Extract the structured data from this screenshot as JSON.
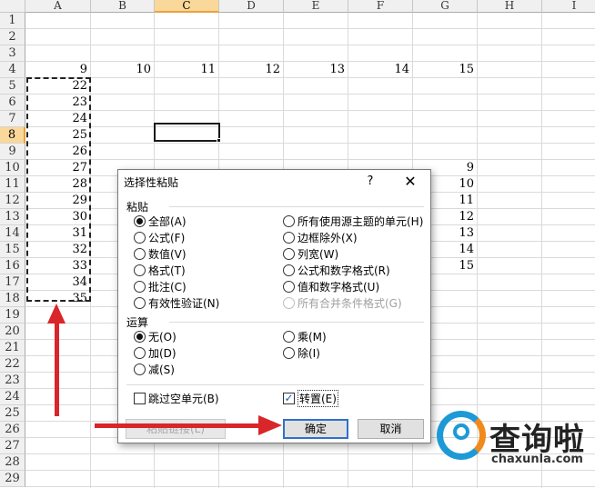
{
  "sheet": {
    "columns": [
      "A",
      "B",
      "C",
      "D",
      "E",
      "F",
      "G",
      "H",
      "I"
    ],
    "selected_column": "C",
    "rows": [
      "1",
      "2",
      "3",
      "4",
      "5",
      "6",
      "7",
      "8",
      "9",
      "10",
      "11",
      "12",
      "13",
      "14",
      "15",
      "16",
      "17",
      "18",
      "19",
      "20",
      "21",
      "22",
      "23",
      "24",
      "25",
      "26",
      "27",
      "28",
      "29"
    ],
    "selected_row": "8",
    "row4_values": [
      "9",
      "10",
      "11",
      "12",
      "13",
      "14",
      "15"
    ],
    "column_a_values": [
      "22",
      "23",
      "24",
      "25",
      "26",
      "27",
      "28",
      "29",
      "30",
      "31",
      "32",
      "33",
      "34",
      "35"
    ],
    "column_g_values": [
      "9",
      "10",
      "11",
      "12",
      "13",
      "14",
      "15"
    ]
  },
  "dialog": {
    "title": "选择性粘贴",
    "help": "?",
    "close": "✕",
    "paste_group": "粘贴",
    "paste_options": [
      {
        "label": "全部(A)",
        "checked": true
      },
      {
        "label": "公式(F)",
        "checked": false
      },
      {
        "label": "数值(V)",
        "checked": false
      },
      {
        "label": "格式(T)",
        "checked": false
      },
      {
        "label": "批注(C)",
        "checked": false
      },
      {
        "label": "有效性验证(N)",
        "checked": false
      }
    ],
    "paste_options_right": [
      {
        "label": "所有使用源主题的单元(H)",
        "checked": false
      },
      {
        "label": "边框除外(X)",
        "checked": false
      },
      {
        "label": "列宽(W)",
        "checked": false
      },
      {
        "label": "公式和数字格式(R)",
        "checked": false
      },
      {
        "label": "值和数字格式(U)",
        "checked": false
      },
      {
        "label": "所有合并条件格式(G)",
        "checked": false,
        "disabled": true
      }
    ],
    "operation_group": "运算",
    "operation_options": [
      {
        "label": "无(O)",
        "checked": true
      },
      {
        "label": "加(D)",
        "checked": false
      },
      {
        "label": "减(S)",
        "checked": false
      }
    ],
    "operation_options_right": [
      {
        "label": "乘(M)",
        "checked": false
      },
      {
        "label": "除(I)",
        "checked": false
      }
    ],
    "skip_blanks": {
      "label": "跳过空单元(B)",
      "checked": false
    },
    "transpose": {
      "label": "转置(E)",
      "checked": true
    },
    "paste_link_label": "粘贴链接(L)",
    "ok_label": "确定",
    "cancel_label": "取消"
  },
  "watermark": {
    "name": "查询啦",
    "url": "chaxunla.com"
  },
  "colors": {
    "accent_arrow": "#d9262a",
    "header_selected": "#f9d899",
    "logo_blue": "#1d9ad6",
    "logo_orange": "#f08a1c"
  }
}
